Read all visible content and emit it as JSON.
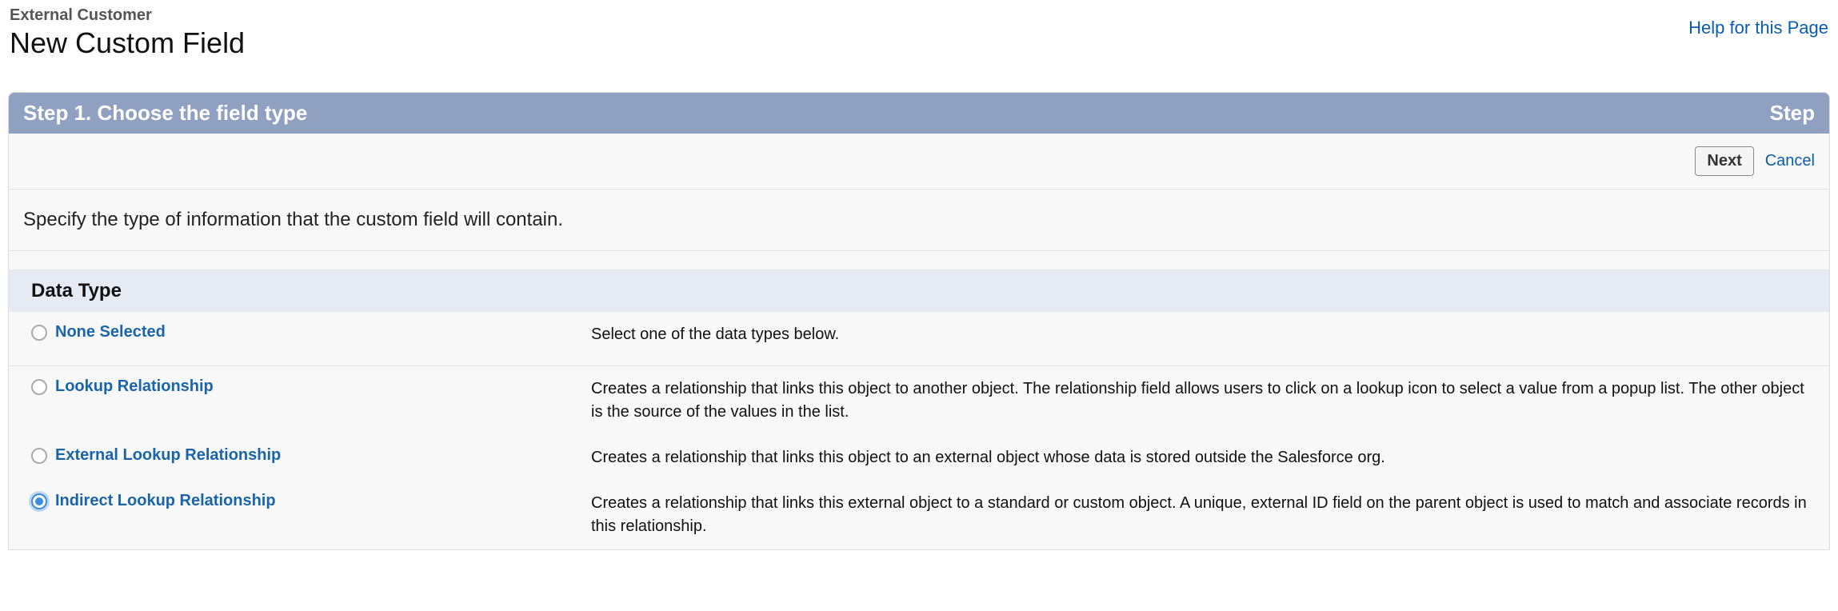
{
  "header": {
    "objectName": "External Customer",
    "pageTitle": "New Custom Field",
    "helpLink": "Help for this Page"
  },
  "step": {
    "title": "Step 1. Choose the field type",
    "stepLabel": "Step",
    "nextButton": "Next",
    "cancelLink": "Cancel",
    "instruction": "Specify the type of information that the custom field will contain."
  },
  "section": {
    "title": "Data Type"
  },
  "options": [
    {
      "id": "none",
      "label": "None Selected",
      "description": "Select one of the data types below.",
      "selected": false
    },
    {
      "id": "lookup",
      "label": "Lookup Relationship",
      "description": "Creates a relationship that links this object to another object. The relationship field allows users to click on a lookup icon to select a value from a popup list. The other object is the source of the values in the list.",
      "selected": false
    },
    {
      "id": "external-lookup",
      "label": "External Lookup Relationship",
      "description": "Creates a relationship that links this object to an external object whose data is stored outside the Salesforce org.",
      "selected": false
    },
    {
      "id": "indirect-lookup",
      "label": "Indirect Lookup Relationship",
      "description": "Creates a relationship that links this external object to a standard or custom object. A unique, external ID field on the parent object is used to match and associate records in this relationship.",
      "selected": true
    }
  ]
}
